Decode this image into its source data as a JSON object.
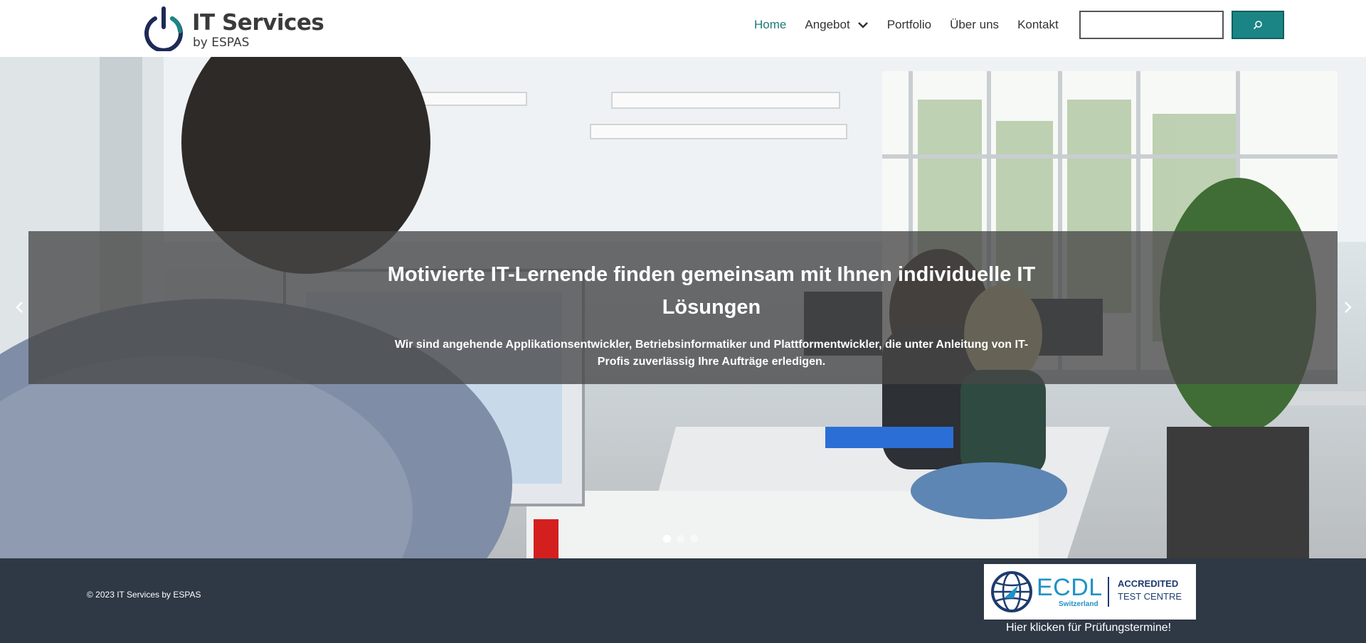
{
  "logo": {
    "title": "IT Services",
    "subtitle": "by ESPAS"
  },
  "nav": {
    "items": [
      {
        "label": "Home",
        "active": true
      },
      {
        "label": "Angebot",
        "has_dropdown": true
      },
      {
        "label": "Portfolio"
      },
      {
        "label": "Über uns"
      },
      {
        "label": "Kontakt"
      }
    ]
  },
  "search": {
    "value": "",
    "button_icon": "search-icon"
  },
  "hero": {
    "title": "Motivierte IT-Lernende finden gemeinsam mit Ihnen individuelle IT Lösungen",
    "text": "Wir sind angehende Applikationsentwickler, Betriebsinformatiker und Plattformentwickler, die unter Anleitung von IT-Profis zuverlässig Ihre Aufträge erledigen.",
    "slides": 3,
    "active_slide": 1,
    "prev_icon": "chevron-left-icon",
    "next_icon": "chevron-right-icon"
  },
  "footer": {
    "copyright": "© 2023 IT Services by ESPAS",
    "ecdl": {
      "word": "ECDL",
      "country": "Switzerland",
      "accredited": "ACCREDITED",
      "test_centre": "TEST CENTRE"
    },
    "exam_link": "Hier klicken für Prüfungstermine!"
  },
  "colors": {
    "accent": "#1d7b7a",
    "search_button": "#1a8584",
    "footer_bg": "#2f3845",
    "ecdl_blue": "#1f93c7",
    "ecdl_navy": "#1d3b6e"
  }
}
